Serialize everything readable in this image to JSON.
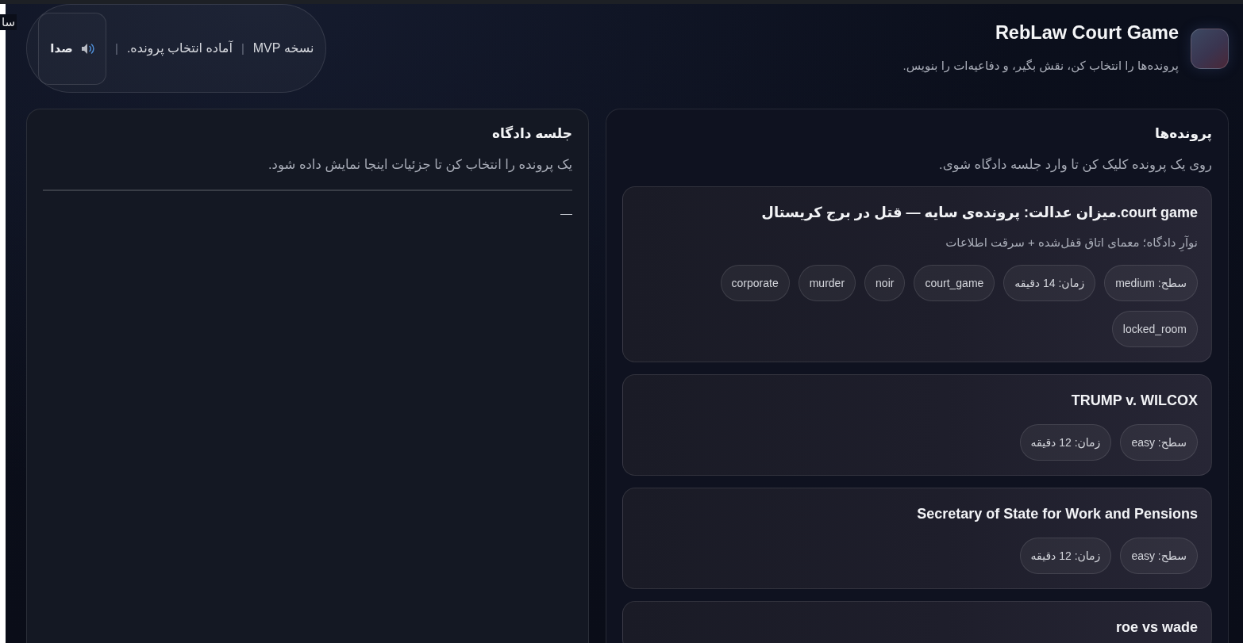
{
  "edge_text": "سا",
  "header": {
    "title": "RebLaw Court Game",
    "subtitle": "پرونده‌ها را انتخاب کن، نقش بگیر، و دفاعیه‌ات را بنویس.",
    "status_bar": [
      {
        "kind": "text",
        "text": "نسخه MVP"
      },
      {
        "kind": "separator",
        "text": "|"
      },
      {
        "kind": "text",
        "text": "آماده انتخاب پرونده."
      },
      {
        "kind": "separator",
        "text": "|"
      },
      {
        "kind": "button",
        "text": "صدا"
      }
    ]
  },
  "cases_panel": {
    "title": "پرونده‌ها",
    "subtitle": "روی یک پرونده کلیک کن تا وارد جلسه دادگاه شوی.",
    "cases": [
      {
        "title": "court game.میزان عدالت: پرونده‌ی سایه — قتل در برج کریستال",
        "description": "نوآرِ دادگاه؛ معمای اتاق قفل‌شده + سرقت اطلاعات",
        "tags": [
          "سطح: medium",
          "زمان: 14 دقیقه",
          "court_game",
          "noir",
          "murder",
          "corporate",
          "locked_room"
        ]
      },
      {
        "title": "TRUMP v. WILCOX",
        "tags": [
          "سطح: easy",
          "زمان: 12 دقیقه"
        ]
      },
      {
        "title": "Secretary of State for Work and Pensions",
        "tags": [
          "سطح: easy",
          "زمان: 12 دقیقه"
        ]
      },
      {
        "title": "roe vs wade"
      }
    ]
  },
  "session_panel": {
    "title": "جلسه دادگاه",
    "subtitle": "یک پرونده را انتخاب کن تا جزئیات اینجا نمایش داده شود.",
    "content": "—"
  }
}
